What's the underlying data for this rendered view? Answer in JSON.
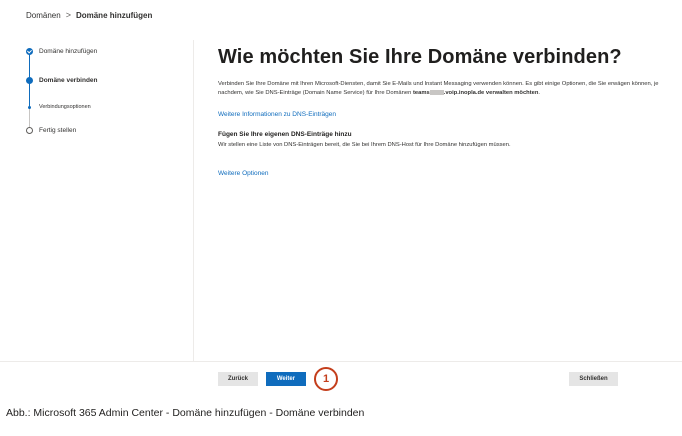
{
  "breadcrumb": {
    "parent": "Domänen",
    "separator": ">",
    "current": "Domäne hinzufügen"
  },
  "wizard_steps": [
    {
      "label": "Domäne hinzufügen",
      "state": "completed"
    },
    {
      "label": "Domäne verbinden",
      "state": "current"
    },
    {
      "label": "Verbindungsoptionen",
      "state": "current-substep"
    },
    {
      "label": "Fertig stellen",
      "state": "pending"
    }
  ],
  "main": {
    "title": "Wie möchten Sie Ihre Domäne verbinden?",
    "intro_text": "Verbinden Sie Ihre Domäne mit Ihren Microsoft-Diensten, damit Sie E-Mails und Instant Messaging verwenden können. Es gibt einige Optionen, die Sie erwägen können, je nachdem, wie Sie DNS-Einträge (Domain Name Service) für Ihre Domänen",
    "domain_prefix": "teams",
    "domain_suffix": ".voip.inopla.de verwalten möchten",
    "intro_end": ".",
    "dns_info_link": "Weitere Informationen zu DNS-Einträgen",
    "section_heading": "Fügen Sie Ihre eigenen DNS-Einträge hinzu",
    "section_text": "Wir stellen eine Liste von DNS-Einträgen bereit, die Sie bei Ihrem DNS-Host für Ihre Domäne hinzufügen müssen.",
    "more_options_link": "Weitere Optionen"
  },
  "footer": {
    "back_label": "Zurück",
    "next_label": "Weiter",
    "close_label": "Schließen",
    "marker_number": "1"
  },
  "caption": "Abb.: Microsoft 365 Admin Center - Domäne hinzufügen - Domäne verbinden",
  "colors": {
    "accent": "#0f6cbd",
    "marker": "#c43e1c"
  },
  "icons": [
    "chevron-right-icon",
    "check-circle-icon"
  ]
}
